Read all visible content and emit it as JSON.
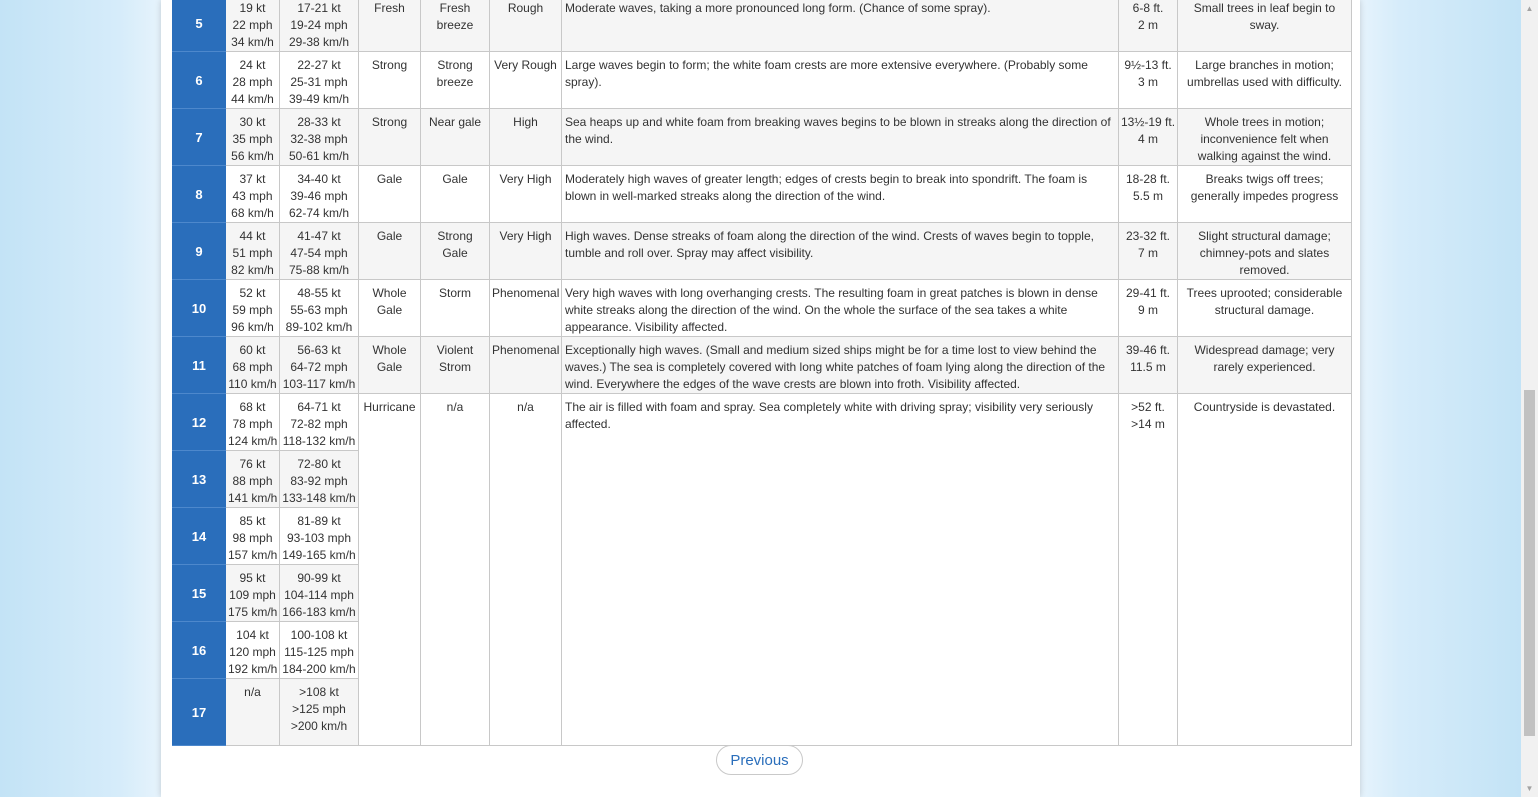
{
  "table": {
    "rows": [
      {
        "force": "5",
        "speed": [
          "19 kt",
          "22 mph",
          "34 km/h"
        ],
        "range": [
          "17-21 kt",
          "19-24 mph",
          "29-38 km/h"
        ],
        "desc1": "Fresh",
        "desc2": "Fresh breeze",
        "sea": "Rough",
        "waves": "Moderate waves, taking a more pronounced long form. (Chance of some spray).",
        "height": [
          "6-8 ft.",
          "2 m"
        ],
        "land": "Small trees in leaf begin to sway."
      },
      {
        "force": "6",
        "speed": [
          "24 kt",
          "28 mph",
          "44 km/h"
        ],
        "range": [
          "22-27 kt",
          "25-31 mph",
          "39-49 km/h"
        ],
        "desc1": "Strong",
        "desc2": "Strong breeze",
        "sea": "Very Rough",
        "waves": "Large waves begin to form; the white foam crests are more extensive everywhere. (Probably some spray).",
        "height": [
          "9½-13 ft.",
          "3 m"
        ],
        "land": "Large branches in motion; umbrellas used with difficulty."
      },
      {
        "force": "7",
        "speed": [
          "30 kt",
          "35 mph",
          "56 km/h"
        ],
        "range": [
          "28-33 kt",
          "32-38 mph",
          "50-61 km/h"
        ],
        "desc1": "Strong",
        "desc2": "Near gale",
        "sea": "High",
        "waves": "Sea heaps up and white foam from breaking waves begins to be blown in streaks along the direction of the wind.",
        "height": [
          "13½-19 ft.",
          "4 m"
        ],
        "land": "Whole trees in motion; inconvenience felt when walking against the wind."
      },
      {
        "force": "8",
        "speed": [
          "37 kt",
          "43 mph",
          "68 km/h"
        ],
        "range": [
          "34-40 kt",
          "39-46 mph",
          "62-74 km/h"
        ],
        "desc1": "Gale",
        "desc2": "Gale",
        "sea": "Very High",
        "waves": "Moderately high waves of greater length; edges of crests begin to break into spondrift. The foam is blown in well-marked streaks along the direction of the wind.",
        "height": [
          "18-28 ft.",
          "5.5 m"
        ],
        "land": "Breaks twigs off trees; generally impedes progress"
      },
      {
        "force": "9",
        "speed": [
          "44 kt",
          "51 mph",
          "82 km/h"
        ],
        "range": [
          "41-47 kt",
          "47-54 mph",
          "75-88 km/h"
        ],
        "desc1": "Gale",
        "desc2": "Strong Gale",
        "sea": "Very High",
        "waves": "High waves. Dense streaks of foam along the direction of the wind. Crests of waves begin to topple, tumble and roll over. Spray may affect visibility.",
        "height": [
          "23-32 ft.",
          "7 m"
        ],
        "land": "Slight structural damage; chimney-pots and slates removed."
      },
      {
        "force": "10",
        "speed": [
          "52 kt",
          "59 mph",
          "96 km/h"
        ],
        "range": [
          "48-55 kt",
          "55-63 mph",
          "89-102 km/h"
        ],
        "desc1": "Whole Gale",
        "desc2": "Storm",
        "sea": "Phenomenal",
        "waves": "Very high waves with long overhanging crests. The resulting foam in great patches is blown in dense white streaks along the direction of the wind. On the whole the surface of the sea takes a white appearance. Visibility affected.",
        "height": [
          "29-41 ft.",
          "9 m"
        ],
        "land": "Trees uprooted; considerable structural damage."
      },
      {
        "force": "11",
        "speed": [
          "60 kt",
          "68 mph",
          "110 km/h"
        ],
        "range": [
          "56-63 kt",
          "64-72 mph",
          "103-117 km/h"
        ],
        "desc1": "Whole Gale",
        "desc2": "Violent Strom",
        "sea": "Phenomenal",
        "waves": "Exceptionally high waves. (Small and medium sized ships might be for a time lost to view behind the waves.) The sea is completely covered with long white patches of foam lying along the direction of the wind. Everywhere the edges of the wave crests are blown into froth. Visibility affected.",
        "height": [
          "39-46 ft.",
          "11.5 m"
        ],
        "land": "Widespread damage; very rarely experienced."
      },
      {
        "force": "12",
        "speed": [
          "68 kt",
          "78 mph",
          "124 km/h"
        ],
        "range": [
          "64-71 kt",
          "72-82 mph",
          "118-132 km/h"
        ],
        "desc1": "Hurricane",
        "desc2": "n/a",
        "sea": "n/a",
        "waves": "The air is filled with foam and spray. Sea completely white with driving spray; visibility very seriously affected.",
        "height": [
          ">52 ft.",
          ">14 m"
        ],
        "land": "Countryside is devastated."
      },
      {
        "force": "13",
        "speed": [
          "76 kt",
          "88 mph",
          "141 km/h"
        ],
        "range": [
          "72-80 kt",
          "83-92 mph",
          "133-148 km/h"
        ]
      },
      {
        "force": "14",
        "speed": [
          "85 kt",
          "98 mph",
          "157 km/h"
        ],
        "range": [
          "81-89 kt",
          "93-103 mph",
          "149-165 km/h"
        ]
      },
      {
        "force": "15",
        "speed": [
          "95 kt",
          "109 mph",
          "175 km/h"
        ],
        "range": [
          "90-99 kt",
          "104-114 mph",
          "166-183 km/h"
        ]
      },
      {
        "force": "16",
        "speed": [
          "104 kt",
          "120 mph",
          "192 km/h"
        ],
        "range": [
          "100-108 kt",
          "115-125 mph",
          "184-200 km/h"
        ]
      },
      {
        "force": "17",
        "speed": [
          "n/a"
        ],
        "range": [
          ">108 kt",
          ">125 mph",
          ">200 km/h"
        ]
      }
    ]
  },
  "pagination": {
    "previous_label": "Previous"
  },
  "colors": {
    "force_cell": "#2a6ebb",
    "row_alt": "#f5f5f5",
    "border": "#c8c8c8",
    "button_text": "#2a6ebb"
  },
  "icons": {
    "scroll_up": "scroll-up-arrow-icon",
    "scroll_down": "scroll-down-arrow-icon"
  }
}
